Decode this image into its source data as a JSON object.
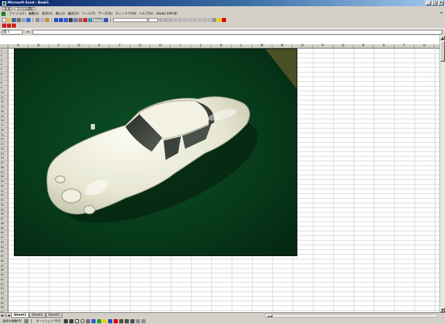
{
  "window": {
    "title": "Microsoft Excel - Book1"
  },
  "ime_bar": {
    "items": [
      "あ 般",
      "アイテム選択"
    ]
  },
  "menu": {
    "items": [
      "ファイル(F)",
      "編集(E)",
      "表示(V)",
      "挿入(I)",
      "書式(O)",
      "ツール(T)",
      "データ(D)",
      "ウィンドウ(W)",
      "ヘルプ(H)",
      "Adobe PDF(B)"
    ]
  },
  "toolbar": {
    "zoom": "100%",
    "icons": [
      "new-icon",
      "open-icon",
      "save-icon",
      "print-icon",
      "preview-icon",
      "spell-icon",
      "cut-icon",
      "copy-icon",
      "paste-icon",
      "undo-icon",
      "redo-icon",
      "hyperlink-icon",
      "sum-icon",
      "sort-asc-icon",
      "sort-desc-icon",
      "chart-icon",
      "drawing-icon",
      "help-icon"
    ],
    "format_icons": [
      "bold-icon",
      "italic-icon",
      "underline-icon",
      "align-left-icon",
      "align-center-icon",
      "align-right-icon",
      "merge-icon",
      "currency-icon",
      "percent-icon",
      "comma-icon",
      "indent-icon",
      "border-icon",
      "fill-color-icon",
      "font-color-icon"
    ],
    "colors": {
      "pdf_red": "#d02020",
      "fill_yellow": "#f0d000",
      "font_red": "#e00000",
      "accent_blue": "#2050c0"
    }
  },
  "formula_bar": {
    "name_box": "図 1",
    "fx": "="
  },
  "grid": {
    "columns": [
      "A",
      "B",
      "C",
      "D",
      "E",
      "F",
      "G",
      "H",
      "I",
      "J",
      "K",
      "L",
      "M",
      "N",
      "O",
      "P",
      "Q",
      "R",
      "S",
      "T",
      "U"
    ],
    "rows": [
      "1",
      "2",
      "3",
      "4",
      "5",
      "6",
      "7",
      "8",
      "9",
      "10",
      "11",
      "12",
      "13",
      "14",
      "15",
      "16",
      "17",
      "18",
      "19",
      "20",
      "21",
      "22",
      "23",
      "24",
      "25",
      "26",
      "27",
      "28",
      "29",
      "30",
      "31",
      "32",
      "33",
      "34",
      "35",
      "36",
      "37",
      "38",
      "39",
      "40",
      "41",
      "42",
      "43",
      "44",
      "45",
      "46",
      "47",
      "48",
      "49",
      "50",
      "51",
      "52",
      "53",
      "54",
      "55",
      "56",
      "57"
    ]
  },
  "image": {
    "subject": "white-car-model-photo",
    "background": "#0a4a22"
  },
  "sheets": {
    "tabs": [
      "Sheet1",
      "Sheet2",
      "Sheet3"
    ],
    "active": "Sheet1"
  },
  "drawing_bar": {
    "draw_label": "図形の調整(R)",
    "autoshape_label": "オートシェイプ(U)"
  }
}
